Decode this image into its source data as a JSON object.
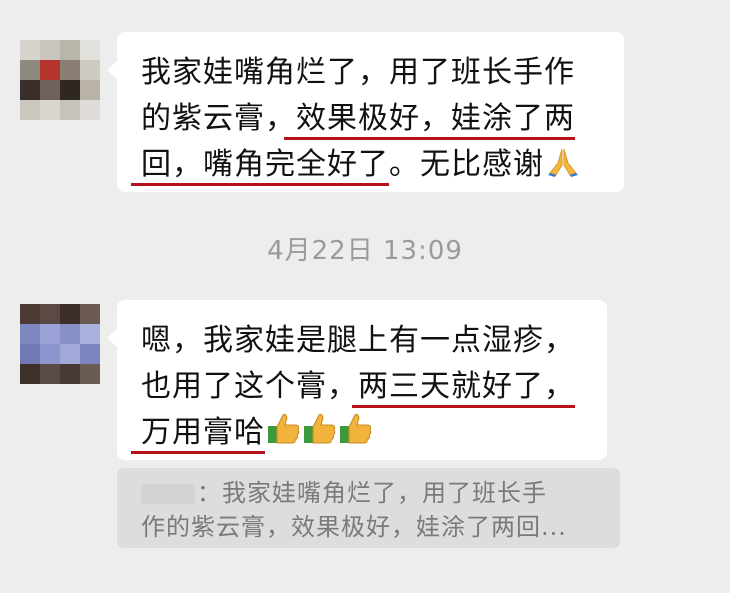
{
  "chat": {
    "message1": {
      "line1": "我家娃嘴角烂了，用了班长手作",
      "line2_plain": "的紫云膏，",
      "line2_highlight": "效果极好，娃涂了两",
      "line3_highlight": "回，嘴角完全好了",
      "line3_plain": "。无比感谢",
      "emoji": "pray-emoji"
    },
    "timestamp": "4月22日 13:09",
    "message2": {
      "line1": "嗯，我家娃是腿上有一点湿疹，",
      "line2_plain": "也用了这个膏，",
      "line2_highlight": "两三天就好了，",
      "line3_highlight": "万用膏哈",
      "emoji": "thumbs-up-emoji"
    },
    "quote": {
      "separator": "：",
      "line1": "我家娃嘴角烂了，用了班长手",
      "line2": "作的紫云膏，效果极好，娃涂了两回..."
    }
  },
  "colors": {
    "background": "#ededed",
    "bubble": "#ffffff",
    "underline": "#b5121b",
    "timestamp": "#9b9b9b",
    "quote_bg": "#dddddd"
  }
}
